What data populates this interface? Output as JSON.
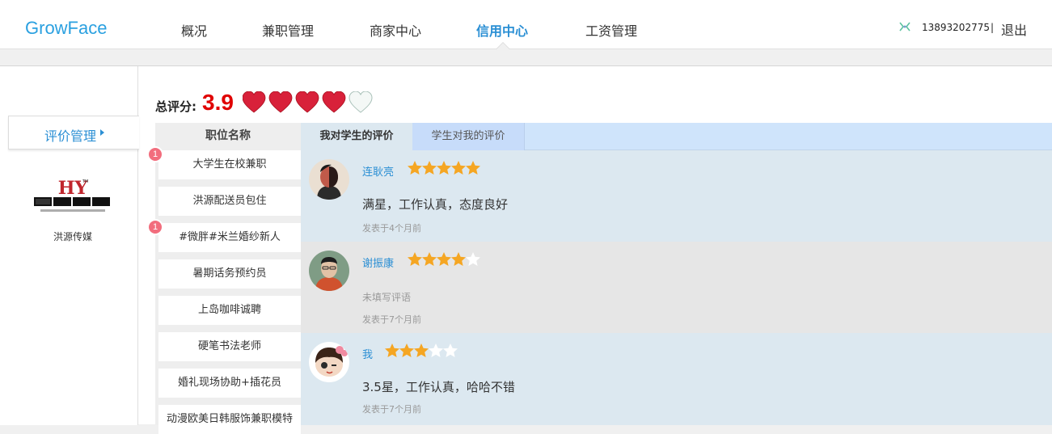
{
  "brand": "GrowFace",
  "nav": {
    "items": [
      {
        "label": "概况"
      },
      {
        "label": "兼职管理"
      },
      {
        "label": "商家中心"
      },
      {
        "label": "信用中心",
        "active": true
      },
      {
        "label": "工资管理"
      }
    ],
    "phone": "13893202775",
    "separator": "|",
    "logout": "退出"
  },
  "sidebar": {
    "tab_label": "评价管理",
    "company_name": "洪源传媒"
  },
  "score": {
    "label": "总评分:",
    "value": "3.9",
    "hearts_filled": 4,
    "hearts_total": 5
  },
  "jobs": {
    "header": "职位名称",
    "items": [
      {
        "label": "大学生在校兼职",
        "badge": "1"
      },
      {
        "label": "洪源配送员包住",
        "badge": ""
      },
      {
        "label": "#微胖#米兰婚纱新人",
        "badge": "1"
      },
      {
        "label": "暑期话务预约员",
        "badge": ""
      },
      {
        "label": "上岛咖啡诚聘",
        "badge": ""
      },
      {
        "label": "硬笔书法老师",
        "badge": ""
      },
      {
        "label": "婚礼现场协助+插花员",
        "badge": ""
      },
      {
        "label": "动漫欧美日韩服饰兼职模特",
        "badge": ""
      }
    ]
  },
  "tabs": [
    {
      "label": "我对学生的评价",
      "active": true
    },
    {
      "label": "学生对我的评价",
      "active": false
    }
  ],
  "reviews": [
    {
      "name": "连耿亮",
      "rating": 5,
      "text": "满星，工作认真，态度良好",
      "time": "发表于4个月前",
      "bg": "#dce8f0"
    },
    {
      "name": "谢振康",
      "rating": 4.5,
      "text": "未填写评语",
      "time": "发表于7个月前",
      "bg": "#e6e6e6",
      "empty": true
    },
    {
      "name": "我",
      "rating": 3.5,
      "text": "3.5星，工作认真，哈哈不错",
      "time": "发表于7个月前",
      "bg": "#dce8f0"
    }
  ],
  "colors": {
    "accent": "#2b8fd4",
    "score_red": "#e00000",
    "heart_red": "#d8213a",
    "star_orange": "#f5a623"
  }
}
